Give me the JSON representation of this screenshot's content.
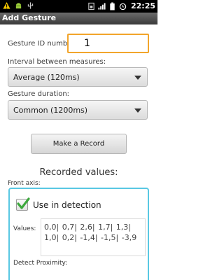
{
  "status_bar": {
    "time": "22:25",
    "icons_left": [
      "warning-icon",
      "android-icon",
      "usb-icon"
    ],
    "icons_right": [
      "sim-icon",
      "signal-icon",
      "battery-icon",
      "alarm-icon"
    ]
  },
  "title": "Add Gesture",
  "form": {
    "gesture_id_label": "Gesture ID number:",
    "gesture_id_value": "1",
    "interval_label": "Interval between measures:",
    "interval_value": "Average (120ms)",
    "duration_label": "Gesture duration:",
    "duration_value": "Common (1200ms)",
    "record_button": "Make a Record"
  },
  "recorded": {
    "title": "Recorded values:",
    "front_axis": {
      "label": "Front axis:",
      "use_in_detection_label": "Use in detection",
      "use_in_detection_checked": true,
      "values_label": "Values:",
      "values_text": "0,0| 0,7| 2,6| 1,7| 1,3| 1,0| 0,2| -1,4| -1,5| -3,9",
      "detect_proximity_label": "Detect Proximity:"
    }
  },
  "colors": {
    "focus_border": "#f2a52b",
    "section_border": "#59c8e3",
    "check": "#3ca83c"
  }
}
